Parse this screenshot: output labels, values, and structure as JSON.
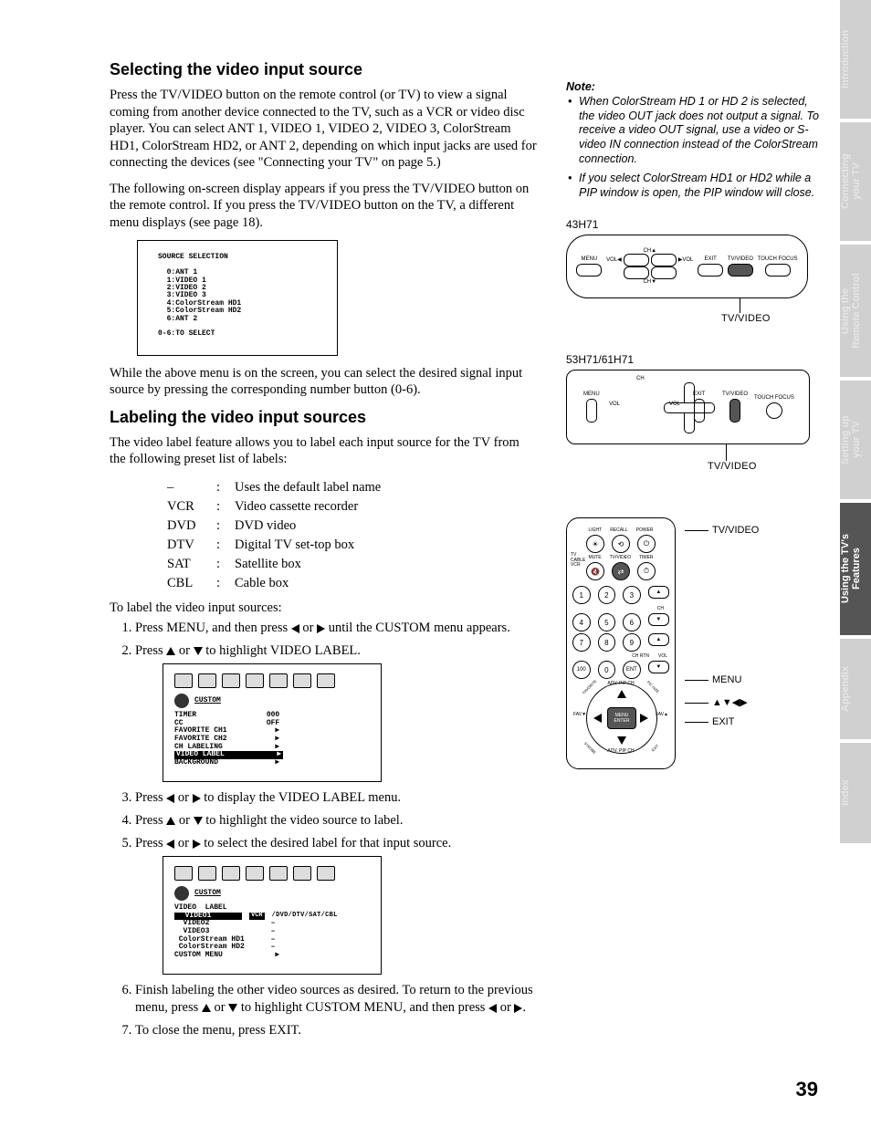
{
  "page_number": "39",
  "tabs": {
    "t1": "Introduction",
    "t2": "Connecting your TV",
    "t3": "Using the Remote Control",
    "t4": "Setting up your TV",
    "t5": "Using the TV's Features",
    "t6": "Appendix",
    "t7": "Index"
  },
  "section1": {
    "heading": "Selecting the video input source",
    "p1": "Press the TV/VIDEO button on the remote control (or TV) to view a signal coming from another device connected to the TV, such as a VCR or video disc player. You can select ANT 1, VIDEO 1, VIDEO 2, VIDEO 3, ColorStream HD1, ColorStream HD2, or ANT 2, depending on which input jacks are used for connecting the devices (see \"Connecting your TV\" on page 5.)",
    "p2": "The following on-screen display appears if you press the TV/VIDEO button on the remote control. If you press the TV/VIDEO button on the TV, a different menu displays (see page 18).",
    "osd_text": "SOURCE SELECTION\n\n  0:ANT 1\n  1:VIDEO 1\n  2:VIDEO 2\n  3:VIDEO 3\n  4:ColorStream HD1\n  5:ColorStream HD2\n  6:ANT 2\n\n0-6:TO SELECT",
    "p3": "While the above menu is on the screen, you can select the desired signal input source by pressing the corresponding number button (0-6)."
  },
  "section2": {
    "heading": "Labeling the video input sources",
    "intro": "The video label feature allows you to label each input source for the TV from the following preset list of labels:",
    "labels": [
      {
        "k": "–",
        "v": "Uses the default label name"
      },
      {
        "k": "VCR",
        "v": "Video cassette recorder"
      },
      {
        "k": "DVD",
        "v": "DVD video"
      },
      {
        "k": "DTV",
        "v": "Digital TV set-top box"
      },
      {
        "k": "SAT",
        "v": "Satellite box"
      },
      {
        "k": "CBL",
        "v": "Cable box"
      }
    ],
    "lead": "To label the video input sources:",
    "steps": {
      "s1a": "Press MENU, and then press ",
      "s1b": " or ",
      "s1c": " until the CUSTOM menu appears.",
      "s2a": "Press ",
      "s2b": " or ",
      "s2c": " to highlight VIDEO LABEL.",
      "s3a": "Press ",
      "s3b": " or ",
      "s3c": " to display the VIDEO LABEL menu.",
      "s4a": "Press ",
      "s4b": " or ",
      "s4c": " to highlight the video source to label.",
      "s5a": "Press ",
      "s5b": " or ",
      "s5c": " to select the desired label for that input source.",
      "s6a": "Finish labeling the other video sources as desired. To return to the previous menu, press ",
      "s6b": " or ",
      "s6c": " to highlight CUSTOM MENU, and then press ",
      "s6d": " or ",
      "s6e": ".",
      "s7": "To close the menu, press EXIT."
    },
    "osd2": {
      "title": "CUSTOM",
      "lines": "TIMER                000\nCC                   OFF\nFAVORITE CH1           ▶\nFAVORITE CH2           ▶\nCH LABELING            ▶",
      "hl": "VIDEO LABEL            ▶",
      "after": "BACKGROUND             ▶"
    },
    "osd3": {
      "title": "CUSTOM",
      "heading": "VIDEO  LABEL",
      "hl": "  VIDEO1",
      "selval": "VCR",
      "opts": "/DVD/DTV/SAT/CBL",
      "lines": "  VIDEO2              –\n  VIDEO3              –\n ColorStream HD1      –\n ColorStream HD2      –\nCUSTOM MENU            ▶"
    }
  },
  "side": {
    "note_h": "Note:",
    "note1": "When ColorStream HD 1 or HD 2 is selected, the video OUT jack does not output a signal. To receive a video OUT signal, use a video or S-video IN connection instead of the ColorStream connection.",
    "note2": "If you select ColorStream HD1 or HD2 while a PIP window is open, the PIP window will close.",
    "model1": "43H71",
    "model2": "53H71/61H71",
    "tvvideo": "TV/VIDEO",
    "panel_btns": {
      "menu": "MENU",
      "vol": "VOL",
      "ch": "CH",
      "exit": "EXIT",
      "tvvideo": "TV/VIDEO",
      "touch": "TOUCH FOCUS"
    },
    "remote": {
      "row1": [
        "LIGHT",
        "RECALL",
        "POWER"
      ],
      "row2": [
        "MUTE",
        "TV/VIDEO",
        "TIMER"
      ],
      "side": [
        "TV",
        "CABLE",
        "VCR"
      ],
      "nums": [
        "1",
        "2",
        "3",
        "4",
        "5",
        "6",
        "7",
        "8",
        "9",
        "100",
        "0",
        "ENT"
      ],
      "ch": "CH",
      "vol": "VOL",
      "chrtn": "CH RTN",
      "nav_top": "ADV. PIP CH",
      "nav_bot": "ADV. PIP CH",
      "favl": "FAV▼",
      "favr": "FAV▲",
      "menu_enter": "MENU\nENTER",
      "corners": [
        "FAVORITE",
        "PIC SIZE",
        "STROBE",
        "EXIT"
      ]
    },
    "callouts": {
      "tvvideo": "TV/VIDEO",
      "menu": "MENU",
      "arrows": "▲▼◀▶",
      "exit": "EXIT"
    }
  }
}
